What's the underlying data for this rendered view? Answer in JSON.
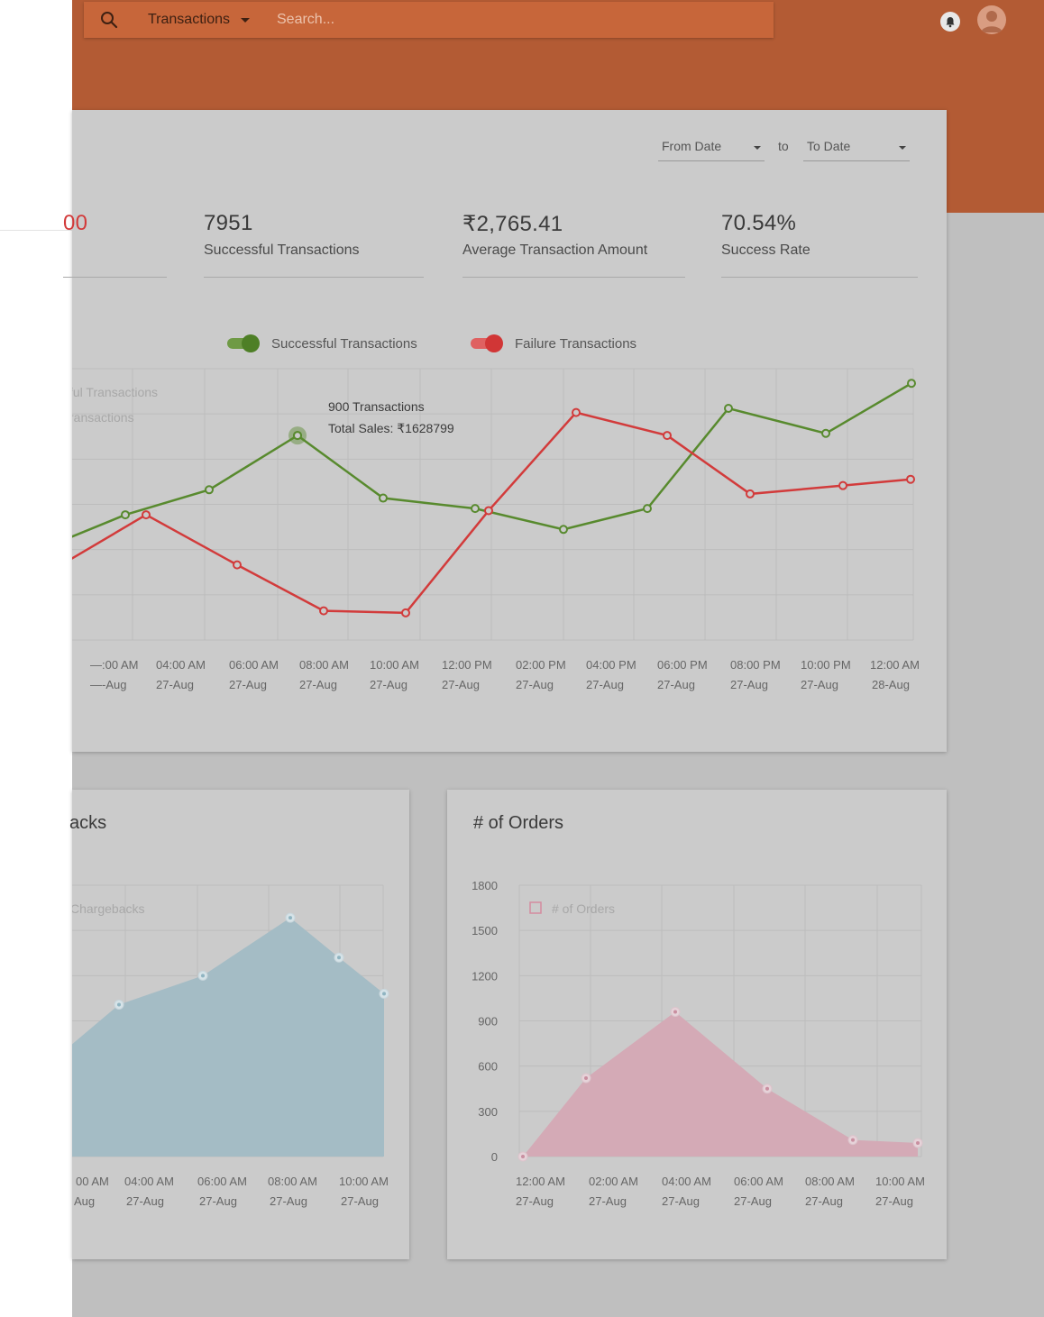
{
  "header": {
    "search_scope": "Transactions",
    "search_placeholder": "Search..."
  },
  "filters": {
    "from_label": "From Date",
    "to_word": "to",
    "to_label": "To Date"
  },
  "stats": [
    {
      "value": "00",
      "label": ""
    },
    {
      "value": "7951",
      "label": "Successful Transactions"
    },
    {
      "value": "₹2,765.41",
      "label": "Average Transaction Amount"
    },
    {
      "value": "70.54%",
      "label": "Success Rate"
    }
  ],
  "toggles": {
    "success": "Successful Transactions",
    "failure": "Failure Transactions"
  },
  "colors": {
    "success": "#588a2e",
    "failure": "#d23b3b",
    "chargebacks": "#a4bcc5",
    "orders": "#d4aab6"
  },
  "chart_data": [
    {
      "type": "line",
      "x_time": [
        "—:00 AM",
        "04:00 AM",
        "06:00 AM",
        "08:00 AM",
        "10:00 AM",
        "12:00 PM",
        "02:00 PM",
        "04:00 PM",
        "06:00 PM",
        "08:00 PM",
        "10:00 PM",
        "12:00 AM"
      ],
      "x_date": [
        "—-Aug",
        "27-Aug",
        "27-Aug",
        "27-Aug",
        "27-Aug",
        "27-Aug",
        "27-Aug",
        "27-Aug",
        "27-Aug",
        "27-Aug",
        "27-Aug",
        "28-Aug"
      ],
      "legend_fragments": [
        "ful Transactions",
        "ransactions"
      ],
      "series": [
        {
          "name": "Successful Transactions",
          "values": [
            580,
            650,
            710,
            840,
            690,
            665,
            615,
            665,
            905,
            845,
            965
          ]
        },
        {
          "name": "Failure Transactions",
          "values": [
            520,
            650,
            530,
            420,
            415,
            660,
            895,
            840,
            700,
            720,
            735
          ]
        }
      ],
      "tooltip": {
        "line1": "900 Transactions",
        "line2": "Total Sales: ₹1628799"
      }
    },
    {
      "type": "area",
      "title_fragment": "acks",
      "legend_fragment": "Chargebacks",
      "x_time": [
        "00 AM",
        "04:00 AM",
        "06:00 AM",
        "08:00 AM",
        "10:00 AM"
      ],
      "x_date": [
        "Aug",
        "27-Aug",
        "27-Aug",
        "27-Aug",
        "27-Aug"
      ],
      "values": [
        30,
        42,
        50,
        66,
        55,
        45
      ]
    },
    {
      "type": "area",
      "title": "# of Orders",
      "legend": "# of Orders",
      "y_ticks": [
        "1800",
        "1500",
        "1200",
        "900",
        "600",
        "300",
        "0"
      ],
      "ylim": [
        0,
        1800
      ],
      "x_time": [
        "12:00 AM",
        "02:00 AM",
        "04:00 AM",
        "06:00 AM",
        "08:00 AM",
        "10:00 AM"
      ],
      "x_date": [
        "27-Aug",
        "27-Aug",
        "27-Aug",
        "27-Aug",
        "27-Aug",
        "27-Aug"
      ],
      "values": [
        0,
        520,
        960,
        450,
        110,
        90
      ]
    }
  ]
}
